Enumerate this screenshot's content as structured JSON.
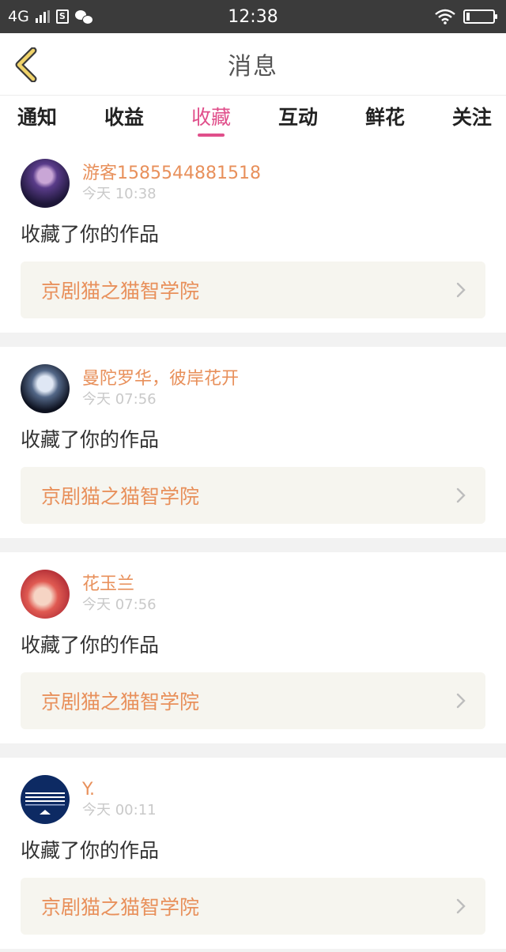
{
  "status_bar": {
    "network": "4G",
    "time": "12:38",
    "icons": [
      "signal-icon",
      "sim-icon",
      "wechat-icon",
      "wifi-icon",
      "battery-icon"
    ]
  },
  "header": {
    "title": "消息",
    "back_icon": "chevron-left-icon",
    "accent": "#e04f8b"
  },
  "tabs": [
    {
      "label": "通知",
      "active": false
    },
    {
      "label": "收益",
      "active": false
    },
    {
      "label": "收藏",
      "active": true
    },
    {
      "label": "互动",
      "active": false
    },
    {
      "label": "鲜花",
      "active": false
    },
    {
      "label": "关注",
      "active": false
    }
  ],
  "messages": [
    {
      "username": "游客1585544881518",
      "time": "今天 10:38",
      "action": "收藏了你的作品",
      "work": "京剧猫之猫智学院"
    },
    {
      "username": "曼陀罗华，彼岸花开",
      "time": "今天 07:56",
      "action": "收藏了你的作品",
      "work": "京剧猫之猫智学院"
    },
    {
      "username": "花玉兰",
      "time": "今天 07:56",
      "action": "收藏了你的作品",
      "work": "京剧猫之猫智学院"
    },
    {
      "username": "Y.",
      "time": "今天 00:11",
      "action": "收藏了你的作品",
      "work": "京剧猫之猫智学院"
    }
  ],
  "colors": {
    "username": "#e8905b",
    "work_title": "#e8905b",
    "work_bg": "#f6f5ef"
  }
}
